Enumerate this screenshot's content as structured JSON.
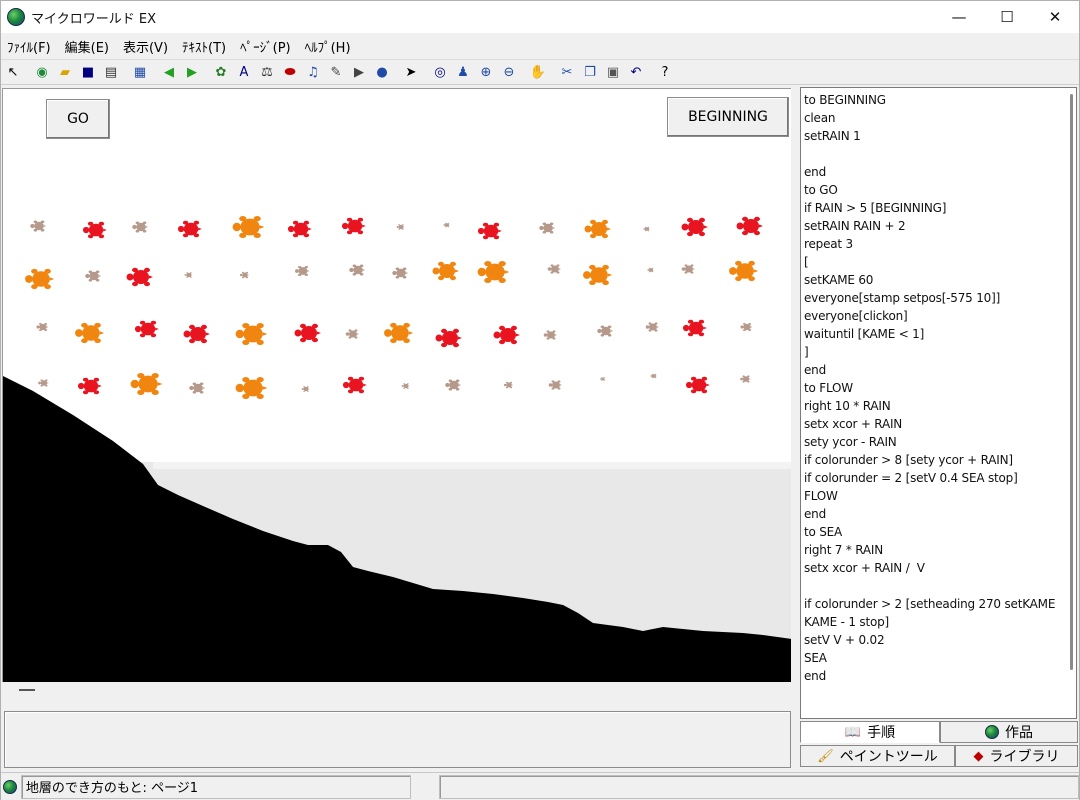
{
  "window": {
    "title": "マイクロワールド EX",
    "controls": {
      "minimize": "—",
      "maximize": "☐",
      "close": "✕"
    }
  },
  "menu": [
    {
      "label": "ﾌｧｲﾙ(F)",
      "name": "menu-file"
    },
    {
      "label": "編集(E)",
      "name": "menu-edit"
    },
    {
      "label": "表示(V)",
      "name": "menu-view"
    },
    {
      "label": "ﾃｷｽﾄ(T)",
      "name": "menu-text"
    },
    {
      "label": "ﾍﾟｰｼﾞ(P)",
      "name": "menu-page"
    },
    {
      "label": "ﾍﾙﾌﾟ(H)",
      "name": "menu-help"
    }
  ],
  "toolbar": [
    {
      "name": "pointer-mode-icon",
      "glyph": "↖",
      "color": "#000000"
    },
    {
      "sep": true
    },
    {
      "name": "new-project-icon",
      "glyph": "◉",
      "color": "#1d8a3a"
    },
    {
      "name": "open-folder-icon",
      "glyph": "▰",
      "color": "#d8a400"
    },
    {
      "name": "save-icon",
      "glyph": "■",
      "color": "#000080"
    },
    {
      "name": "print-icon",
      "glyph": "▤",
      "color": "#333333"
    },
    {
      "sep": true
    },
    {
      "name": "page-list-icon",
      "glyph": "▦",
      "color": "#1e4aa8"
    },
    {
      "sep": true
    },
    {
      "name": "page-back-icon",
      "glyph": "◀",
      "color": "#22a022"
    },
    {
      "name": "page-forward-icon",
      "glyph": "▶",
      "color": "#22a022"
    },
    {
      "sep": true
    },
    {
      "name": "hatch-turtle-icon",
      "glyph": "✿",
      "color": "#2a7a2a"
    },
    {
      "name": "text-box-icon",
      "glyph": "A",
      "color": "#000080"
    },
    {
      "name": "slider-icon",
      "glyph": "⚖",
      "color": "#333333"
    },
    {
      "name": "button-icon",
      "glyph": "⬬",
      "color": "#c00000"
    },
    {
      "name": "music-icon",
      "glyph": "♫",
      "color": "#1e4aa8"
    },
    {
      "name": "paint-tool-icon",
      "glyph": "✎",
      "color": "#444444"
    },
    {
      "name": "video-icon",
      "glyph": "▶",
      "color": "#444444"
    },
    {
      "name": "record-icon",
      "glyph": "●",
      "color": "#1e4aa8"
    },
    {
      "sep": true
    },
    {
      "name": "select-arrow-icon",
      "glyph": "➤",
      "color": "#000000"
    },
    {
      "sep": true
    },
    {
      "name": "eye-icon",
      "glyph": "◎",
      "color": "#000080"
    },
    {
      "name": "stamp-icon",
      "glyph": "♟",
      "color": "#1e4aa8"
    },
    {
      "name": "zoom-in-icon",
      "glyph": "⊕",
      "color": "#1e4aa8"
    },
    {
      "name": "zoom-out-icon",
      "glyph": "⊖",
      "color": "#1e4aa8"
    },
    {
      "sep": true
    },
    {
      "name": "stop-hand-icon",
      "glyph": "✋",
      "color": "#cc0000"
    },
    {
      "sep": true
    },
    {
      "name": "cut-icon",
      "glyph": "✂",
      "color": "#1e4aa8"
    },
    {
      "name": "copy-icon",
      "glyph": "❐",
      "color": "#1e4aa8"
    },
    {
      "name": "paste-icon",
      "glyph": "▣",
      "color": "#555555"
    },
    {
      "name": "undo-icon",
      "glyph": "↶",
      "color": "#000080"
    },
    {
      "sep": true
    },
    {
      "name": "help-icon",
      "glyph": "?",
      "color": "#000000"
    }
  ],
  "stage": {
    "go_button": "GO",
    "beginning_button": "BEGINNING"
  },
  "procedures": [
    "to BEGINNING",
    "clean",
    "setRAIN 1",
    "",
    "end",
    "to GO",
    "if RAIN > 5 [BEGINNING]",
    "setRAIN RAIN + 2",
    "repeat 3",
    "[",
    "setKAME 60",
    "everyone[stamp setpos[-575 10]]",
    "everyone[clickon]",
    "waituntil [KAME < 1]",
    "]",
    "end",
    "to FLOW",
    "right 10 * RAIN",
    "setx xcor + RAIN",
    "sety ycor - RAIN",
    "if colorunder > 8 [sety ycor + RAIN]",
    "if colorunder = 2 [setV 0.4 SEA stop]",
    "FLOW",
    "end",
    "to SEA",
    "right 7 * RAIN",
    "setx xcor + RAIN /  V",
    "",
    "if colorunder > 2 [setheading 270 setKAME",
    "KAME - 1 stop]",
    "setV V + 0.02",
    "SEA",
    "end"
  ],
  "tabs": {
    "procedures": "手順",
    "project": "作品",
    "paint_tools": "ペイントツール",
    "library": "ライブラリ"
  },
  "status": {
    "page_info": "地層のでき方のもと: ページ1",
    "extra": ""
  },
  "colors": {
    "turtle_red": "#e8141f",
    "turtle_orange": "#f0860f",
    "turtle_tan": "#b59a8c",
    "ground": "#000000",
    "sea": "#e8e8e8"
  }
}
